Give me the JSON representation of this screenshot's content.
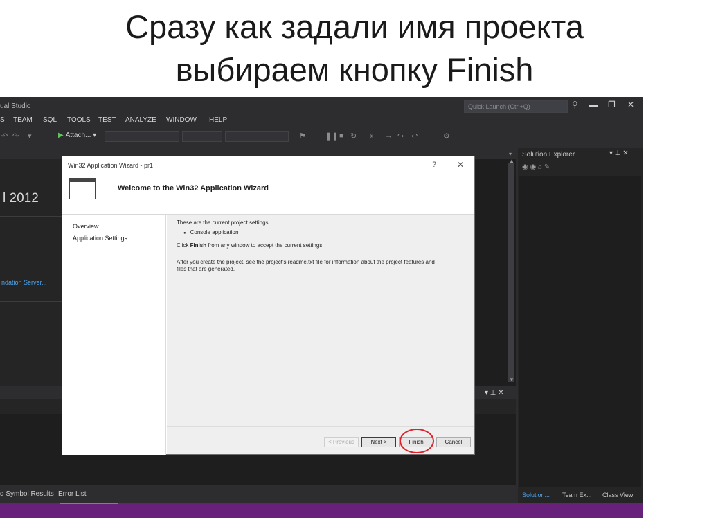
{
  "slide": {
    "title_line1": "Сразу как задали имя проекта",
    "title_line2": "выбираем кнопку Finish"
  },
  "ide": {
    "app_title": "ual Studio",
    "quick_launch_placeholder": "Quick Launch (Ctrl+Q)",
    "menu": [
      "S",
      "TEAM",
      "SQL",
      "TOOLS",
      "TEST",
      "ANALYZE",
      "WINDOW",
      "HELP"
    ],
    "attach_label": "Attach...",
    "left_doc": {
      "version_text": "l 2012",
      "link_text": "ndation Server..."
    },
    "solution_explorer": {
      "title": "Solution Explorer",
      "tabs": [
        "Solution...",
        "Team Ex...",
        "Class View"
      ]
    },
    "bottom_tabs": [
      "d Symbol Results",
      "Error List"
    ],
    "colors": {
      "ide_background": "#2d2d30",
      "editor": "#1e1e1e",
      "status_bar": "#68217a",
      "link": "#4ea2e6",
      "highlight_circle": "#e0202a"
    }
  },
  "dialog": {
    "title": "Win32 Application Wizard - pr1",
    "help": "?",
    "close": "✕",
    "heading": "Welcome to the Win32 Application Wizard",
    "nav": [
      "Overview",
      "Application Settings"
    ],
    "settings_intro": "These are the current project settings:",
    "setting_item": "Console application",
    "finish_line_pre": "Click ",
    "finish_line_bold": "Finish",
    "finish_line_post": " from any window to accept the current settings.",
    "readme_line1": "After you create the project, see the project's readme.txt file for information about the project features and",
    "readme_line2": "files that are generated.",
    "buttons": {
      "previous": "< Previous",
      "next": "Next >",
      "finish": "Finish",
      "cancel": "Cancel"
    }
  }
}
